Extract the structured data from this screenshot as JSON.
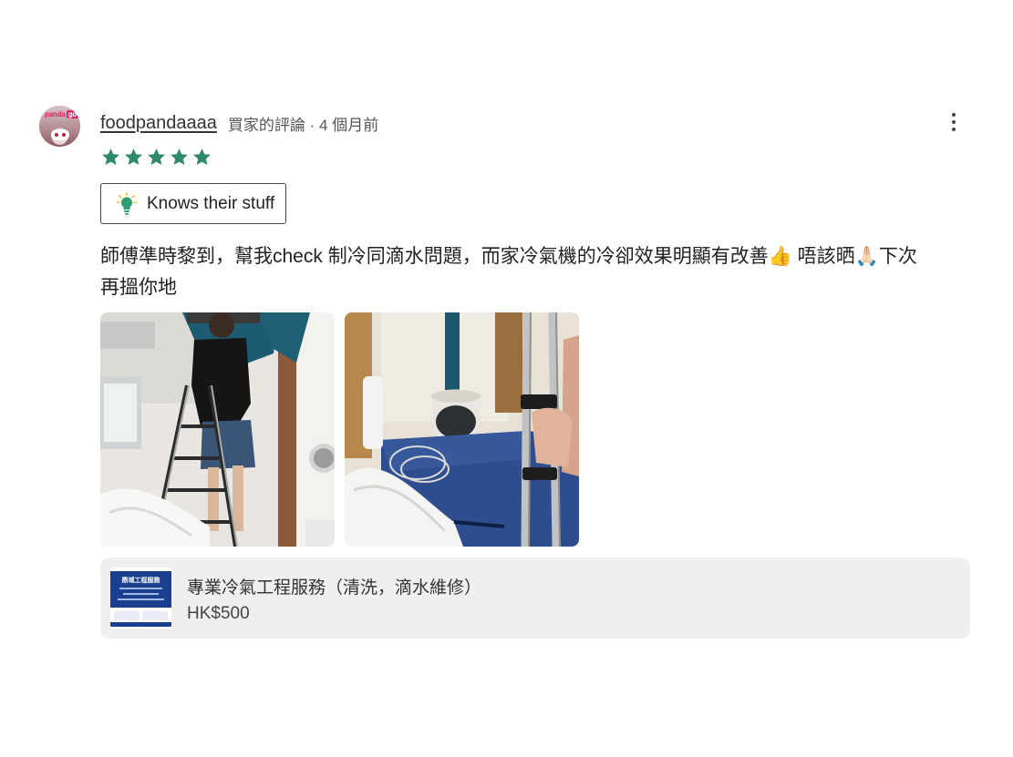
{
  "review": {
    "username": "foodpandaaaa",
    "meta": "買家的評論 · 4 個月前",
    "rating": 5,
    "rating_max": 5,
    "star_color": "#2f8a6b",
    "badge": {
      "icon": "lightbulb-icon",
      "label": "Knows their stuff"
    },
    "comment_line1": "師傅準時黎到，幫我check 制冷同滴水問題，而家冷氣機的冷卻效果明顯有改善👍 唔該晒🙏🏻下次",
    "comment_line2": "再搵你地",
    "photos": [
      {
        "name": "technician-on-ladder-photo"
      },
      {
        "name": "drain-bucket-photo"
      }
    ],
    "avatar_badge": "panda"
  },
  "product": {
    "title": "專業冷氣工程服務（清洗，滴水維修）",
    "price": "HK$500",
    "thumb_heading": "鼎城工程服務",
    "thumb_color": "#1b3f8f"
  }
}
